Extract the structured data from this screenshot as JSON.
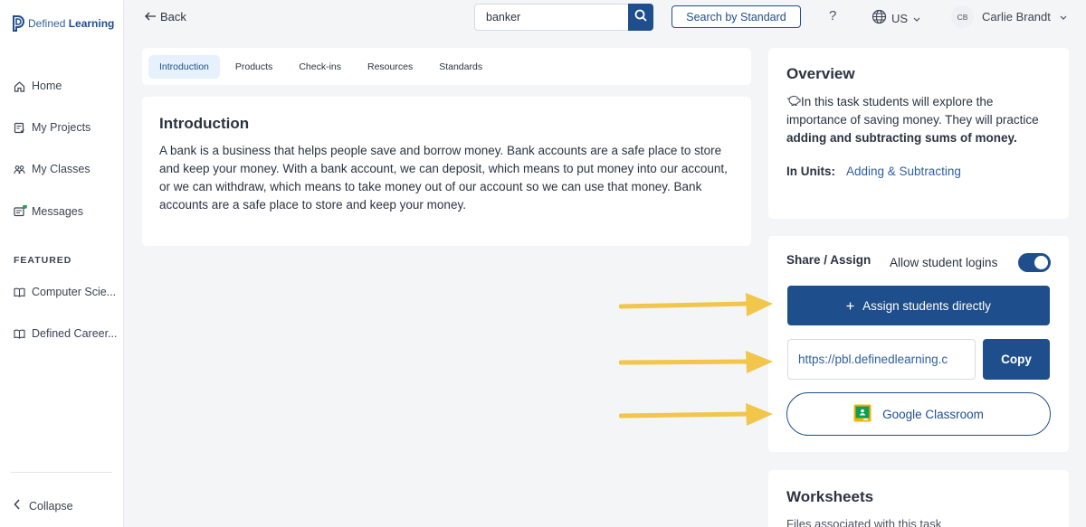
{
  "sidebar": {
    "logo": {
      "light": "Defined ",
      "bold": "Learning"
    },
    "items": [
      {
        "label": "Home",
        "icon": "home-icon"
      },
      {
        "label": "My Projects",
        "icon": "projects-icon"
      },
      {
        "label": "My Classes",
        "icon": "classes-icon"
      },
      {
        "label": "Messages",
        "icon": "messages-icon"
      }
    ],
    "featured_title": "FEATURED",
    "featured": [
      {
        "label": "Computer Scie...",
        "icon": "book-icon"
      },
      {
        "label": "Defined Career...",
        "icon": "book-icon"
      }
    ],
    "collapse_label": "Collapse"
  },
  "topbar": {
    "back_label": "Back",
    "search_value": "banker",
    "search_by_standard": "Search by Standard",
    "help_label": "?",
    "language": "US",
    "user_initials": "CB",
    "user_name": "Carlie Brandt"
  },
  "tabs": [
    {
      "label": "Introduction",
      "active": true
    },
    {
      "label": "Products",
      "active": false
    },
    {
      "label": "Check-ins",
      "active": false
    },
    {
      "label": "Resources",
      "active": false
    },
    {
      "label": "Standards",
      "active": false
    }
  ],
  "introduction": {
    "title": "Introduction",
    "body": "A bank is a business that helps people save and borrow money. Bank accounts are a safe place to store and keep your money.  With a bank account, we can deposit, which means to put money into our account, or we can withdraw, which means to take money out of our account so we can use that money. Bank accounts are a safe place to store and keep your money."
  },
  "overview": {
    "title": "Overview",
    "text_before": "In this task students will explore the importance of saving money. They will practice ",
    "text_bold": "adding and subtracting sums of money.",
    "units_label": "In Units:",
    "units_value": "Adding & Subtracting"
  },
  "share": {
    "title": "Share / Assign",
    "allow_label": "Allow student logins",
    "allow_enabled": true,
    "assign_label": "Assign students directly",
    "link_value": "https://pbl.definedlearning.c",
    "copy_label": "Copy",
    "google_label": "Google Classroom"
  },
  "worksheets": {
    "title": "Worksheets",
    "subtitle": "Files associated with this task"
  },
  "colors": {
    "primary": "#1f4e8c",
    "arrow": "#f2c54b",
    "active_tab_bg": "#e7f1fb",
    "page_bg": "#f4f5f7"
  }
}
